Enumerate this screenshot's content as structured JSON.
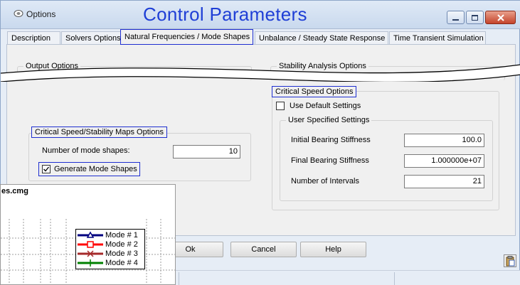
{
  "window": {
    "title": "Options",
    "overlay_title": "Control Parameters"
  },
  "tabs": [
    {
      "label": "Description",
      "active": false
    },
    {
      "label": "Solvers Options",
      "active": false
    },
    {
      "label": "Natural Frequencies / Mode Shapes",
      "active": true
    },
    {
      "label": "Unbalance / Steady State Response",
      "active": false
    },
    {
      "label": "Time Transient Simulation",
      "active": false
    }
  ],
  "output_options": {
    "title": "Output Options"
  },
  "stability_analysis": {
    "title": "Stability Analysis Options"
  },
  "critical_speed_maps": {
    "title": "Critical Speed/Stability Maps Options",
    "mode_shapes_label": "Number of mode shapes:",
    "mode_shapes_value": "10",
    "generate_label": "Generate Mode Shapes",
    "generate_checked": true
  },
  "critical_speed": {
    "title": "Critical Speed Options",
    "use_default_label": "Use Default Settings",
    "use_default_checked": false,
    "user_specified_title": "User Specified Settings",
    "initial_stiffness_label": "Initial Bearing Stiffness",
    "initial_stiffness_value": "100.0",
    "final_stiffness_label": "Final Bearing Stiffness",
    "final_stiffness_value": "1.000000e+07",
    "intervals_label": "Number of Intervals",
    "intervals_value": "21"
  },
  "buttons": {
    "ok": "Ok",
    "cancel": "Cancel",
    "help": "Help"
  },
  "plot_window": {
    "title": "es.cmg",
    "legend": [
      {
        "label": "Mode # 1",
        "color": "#00007f",
        "marker": "triangle"
      },
      {
        "label": "Mode # 2",
        "color": "#ff0000",
        "marker": "square"
      },
      {
        "label": "Mode # 3",
        "color": "#a52a2a",
        "marker": "x"
      },
      {
        "label": "Mode # 4",
        "color": "#008000",
        "marker": "plus"
      }
    ]
  },
  "colors": {
    "highlight_border": "#1e2ed0",
    "overlay_title": "#1f3fd6"
  }
}
